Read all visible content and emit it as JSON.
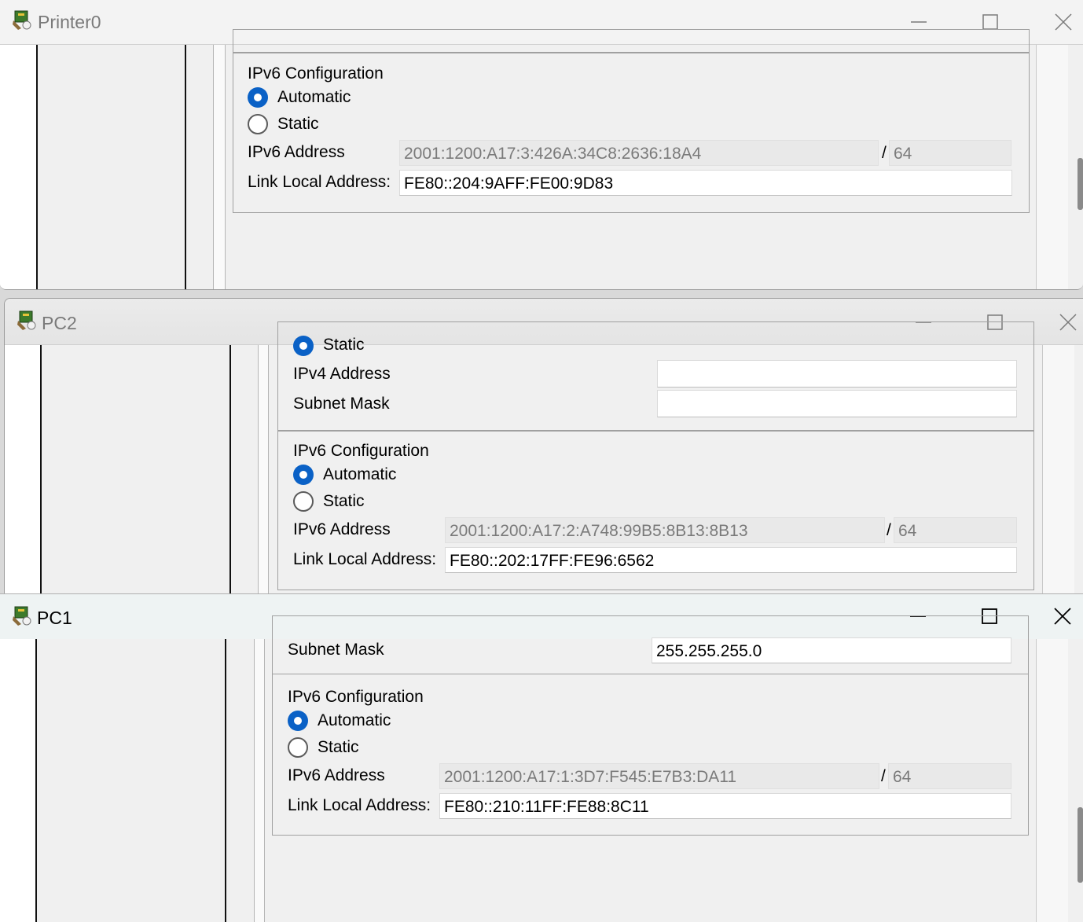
{
  "windows": {
    "printer0": {
      "title": "Printer0",
      "ipv6_config": {
        "heading": "IPv6 Configuration",
        "automatic_label": "Automatic",
        "static_label": "Static",
        "mode": "Automatic",
        "ipv6_address_label": "IPv6 Address",
        "ipv6_address": "2001:1200:A17:3:426A:34C8:2636:18A4",
        "prefix_separator": "/",
        "prefix_length": "64",
        "link_local_label": "Link Local Address:",
        "link_local_address": "FE80::204:9AFF:FE00:9D83"
      }
    },
    "pc2": {
      "title": "PC2",
      "ipv4_config": {
        "static_label": "Static",
        "ipv4_address_label": "IPv4 Address",
        "ipv4_address": "",
        "subnet_mask_label": "Subnet Mask",
        "subnet_mask": ""
      },
      "ipv6_config": {
        "heading": "IPv6 Configuration",
        "automatic_label": "Automatic",
        "static_label": "Static",
        "mode": "Automatic",
        "ipv6_address_label": "IPv6 Address",
        "ipv6_address": "2001:1200:A17:2:A748:99B5:8B13:8B13",
        "prefix_separator": "/",
        "prefix_length": "64",
        "link_local_label": "Link Local Address:",
        "link_local_address": "FE80::202:17FF:FE96:6562"
      }
    },
    "pc1": {
      "title": "PC1",
      "ipv4_config": {
        "subnet_mask_label": "Subnet Mask",
        "subnet_mask": "255.255.255.0"
      },
      "ipv6_config": {
        "heading": "IPv6 Configuration",
        "automatic_label": "Automatic",
        "static_label": "Static",
        "mode": "Automatic",
        "ipv6_address_label": "IPv6 Address",
        "ipv6_address": "2001:1200:A17:1:3D7:F545:E7B3:DA11",
        "prefix_separator": "/",
        "prefix_length": "64",
        "link_local_label": "Link Local Address:",
        "link_local_address": "FE80::210:11FF:FE88:8C11"
      }
    }
  },
  "icons": {
    "app": "packet-tracer-device-icon",
    "minimize": "minimize-icon",
    "maximize": "maximize-icon",
    "close": "close-icon"
  },
  "colors": {
    "radio_selected": "#0a61c6",
    "window_bg": "#f0f0f0",
    "readonly_field": "#e9e9e9"
  }
}
